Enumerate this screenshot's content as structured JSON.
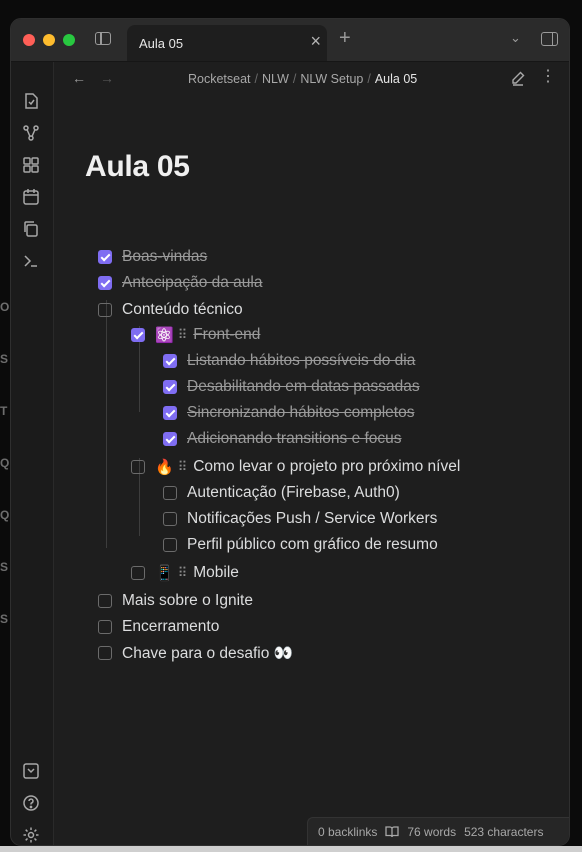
{
  "tab": {
    "title": "Aula 05"
  },
  "breadcrumb": [
    "Rocketseat",
    "NLW",
    "NLW Setup"
  ],
  "breadcrumb_current": "Aula 05",
  "page": {
    "title": "Aula 05"
  },
  "tasks": [
    {
      "label": "Boas-vindas",
      "checked": true
    },
    {
      "label": "Antecipação da aula",
      "checked": true
    },
    {
      "label": "Conteúdo técnico",
      "checked": false
    },
    {
      "emoji": "⚛️",
      "label": "Front-end",
      "checked": true
    },
    {
      "label": "Listando hábitos possíveis do dia",
      "checked": true
    },
    {
      "label": "Desabilitando em datas passadas",
      "checked": true
    },
    {
      "label": "Sincronizando hábitos completos",
      "checked": true
    },
    {
      "label": "Adicionando transitions e focus",
      "checked": true
    },
    {
      "emoji": "🔥",
      "label": "Como levar o projeto pro próximo nível",
      "checked": false
    },
    {
      "label": "Autenticação (Firebase, Auth0)",
      "checked": false
    },
    {
      "label": "Notificações Push / Service Workers",
      "checked": false
    },
    {
      "label": "Perfil público com gráfico de resumo",
      "checked": false
    },
    {
      "emoji": "📱",
      "label": "Mobile",
      "checked": false
    },
    {
      "label": "Mais sobre o Ignite",
      "checked": false
    },
    {
      "label": "Encerramento",
      "checked": false
    },
    {
      "label": "Chave para o desafio 👀",
      "checked": false
    }
  ],
  "status": {
    "backlinks": "0 backlinks",
    "words": "76 words",
    "characters": "523 characters"
  },
  "icons": {
    "ribbon": [
      "open-file-icon",
      "graph-view-icon",
      "canvas-icon",
      "daily-note-icon",
      "copy-icon",
      "command-palette-icon",
      "vault-switch-icon",
      "help-icon",
      "settings-icon"
    ]
  },
  "colors": {
    "accent": "#7f6df2",
    "background": "#1e1e1e"
  }
}
